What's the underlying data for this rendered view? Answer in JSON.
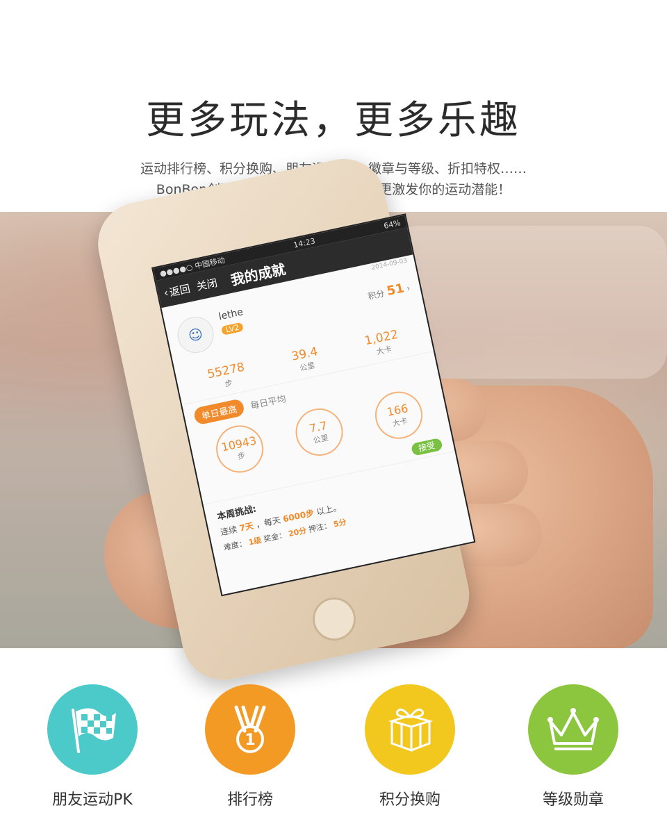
{
  "header": {
    "title": "更多玩法，更多乐趣",
    "subtitle_line1": "运动排行榜、积分换购、朋友运动PK、徽章与等级、折扣特权……",
    "subtitle_line2": "BonBon创造了你想不到的好玩功能，更激发你的运动潜能！"
  },
  "phone": {
    "status": {
      "carrier": "●●●●○ 中国移动",
      "time": "14:23",
      "battery": "64%"
    },
    "nav": {
      "back": "返回",
      "close": "关闭",
      "title": "我的成就"
    },
    "date": "2014-09-03",
    "profile": {
      "name": "lethe",
      "level": "LV2",
      "points_label": "积分",
      "points_value": "51"
    },
    "totals": [
      {
        "value": "55278",
        "unit": "步"
      },
      {
        "value": "39.4",
        "unit": "公里"
      },
      {
        "value": "1,022",
        "unit": "大卡"
      }
    ],
    "tabs": {
      "active": "单日最高",
      "inactive": "每日平均"
    },
    "daily": [
      {
        "value": "10943",
        "unit": "步"
      },
      {
        "value": "7.7",
        "unit": "公里"
      },
      {
        "value": "166",
        "unit": "大卡"
      }
    ],
    "accept_button": "接受",
    "challenge": {
      "title": "本周挑战:",
      "line1_a": "连续",
      "line1_days": "7天",
      "line1_b": "，每天",
      "line1_steps": "6000步",
      "line1_c": "以上。",
      "line2_a": "难度：",
      "line2_diff": "1级",
      "line2_b": "奖金：",
      "line2_bonus": "20分",
      "line2_c": "押注：",
      "line2_bet": "5分"
    }
  },
  "features": [
    {
      "label": "朋友运动PK",
      "icon": "checkered-flag-icon",
      "color": "#4cc9c9"
    },
    {
      "label": "排行榜",
      "icon": "medal-icon",
      "color": "#f39a25"
    },
    {
      "label": "积分换购",
      "icon": "gift-box-icon",
      "color": "#f2c81e"
    },
    {
      "label": "等级勋章",
      "icon": "crown-icon",
      "color": "#8cc63f"
    }
  ]
}
